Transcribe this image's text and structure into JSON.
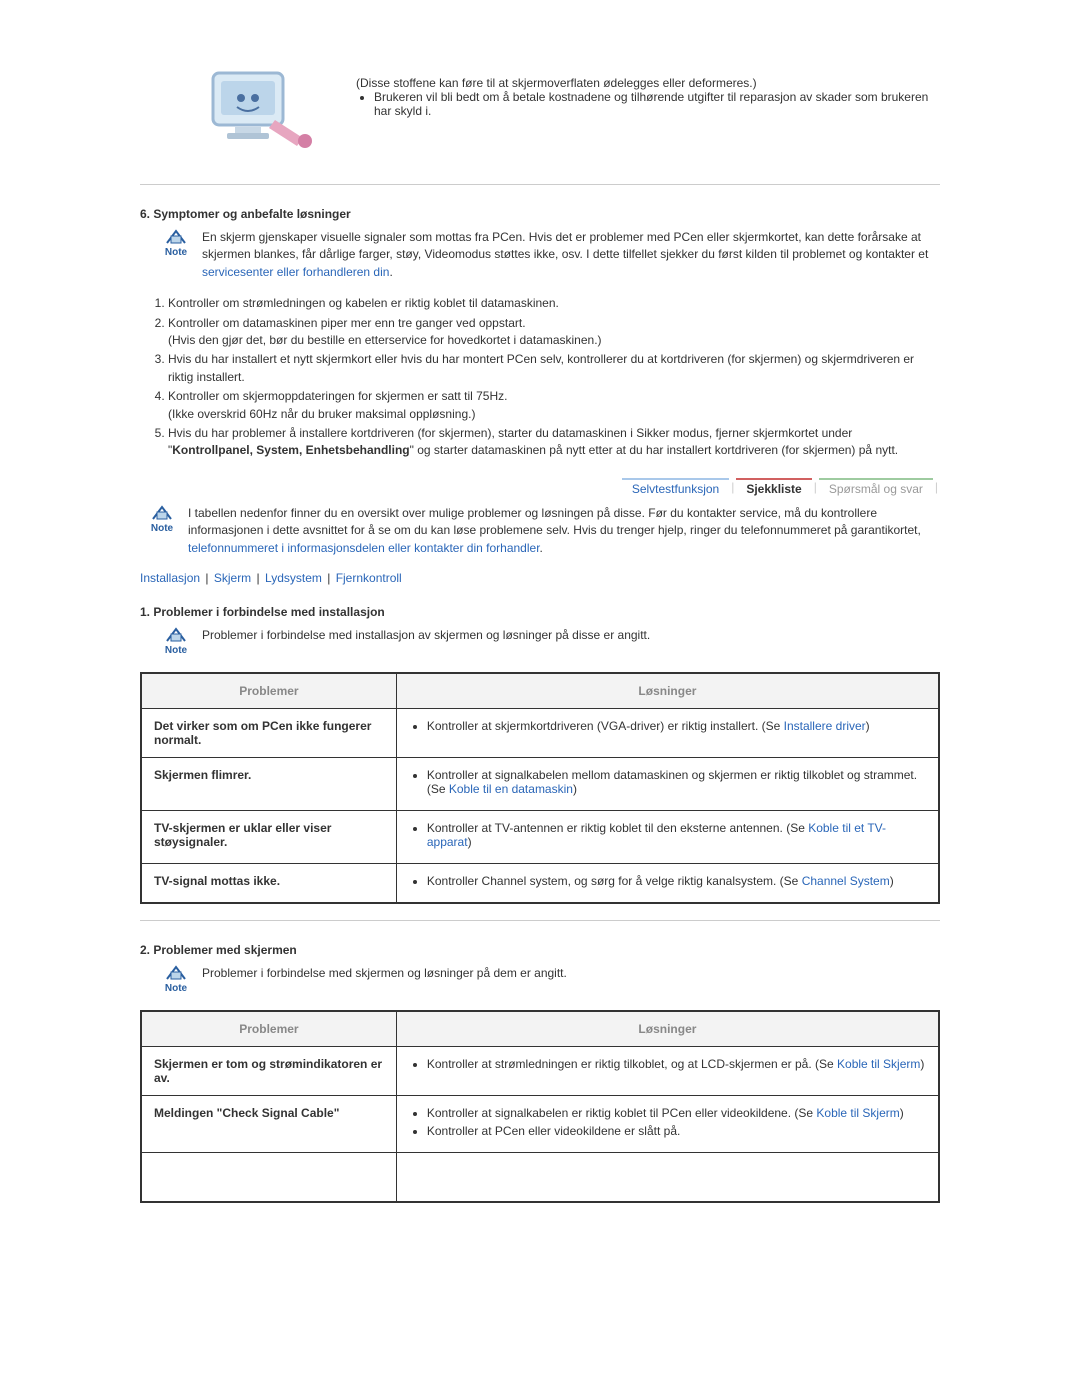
{
  "top": {
    "line1": "(Disse stoffene kan føre til at skjermoverflaten ødelegges eller deformeres.)",
    "line2_a": "Brukeren vil bli bedt om å betale kostnadene og tilhørende utgifter til reparasjon av skader som brukeren har skyld i."
  },
  "section6": {
    "title": "6. Symptomer og anbefalte løsninger",
    "note_label": "Note",
    "note_text_pre": "En skjerm gjenskaper visuelle signaler som mottas fra PCen. Hvis det er problemer med PCen eller skjermkortet, kan dette forårsake at skjermen blankes, får dårlige farger, støy, Videomodus støttes ikke, osv. I dette tilfellet sjekker du først kilden til problemet og kontakter et ",
    "note_link_text": "servicesenter eller forhandleren din",
    "note_text_post": ".",
    "checklist": {
      "i1": "Kontroller om strømledningen og kabelen er riktig koblet til datamaskinen.",
      "i2a": "Kontroller om datamaskinen piper mer enn tre ganger ved oppstart.",
      "i2b": "(Hvis den gjør det, bør du bestille en etterservice for hovedkortet i datamaskinen.)",
      "i3": "Hvis du har installert et nytt skjermkort eller hvis du har montert PCen selv, kontrollerer du at kortdriveren (for skjermen) og skjermdriveren er riktig installert.",
      "i4a": "Kontroller om skjermoppdateringen for skjermen er satt til 75Hz.",
      "i4b": "(Ikke overskrid 60Hz når du bruker maksimal oppløsning.)",
      "i5_pre": "Hvis du har problemer å installere kortdriveren (for skjermen), starter du datamaskinen i Sikker modus, fjerner skjermkortet under \"",
      "i5_bold": "Kontrollpanel, System, Enhetsbehandling",
      "i5_post": "\" og starter datamaskinen på nytt etter at du har installert kortdriveren (for skjermen) på nytt."
    }
  },
  "tabs_img": {
    "selvtest": "Selvtestfunksjon",
    "sjekkliste": "Sjekkliste",
    "sporsmal": "Spørsmål og svar"
  },
  "intro2": {
    "note_label": "Note",
    "text_pre": "I tabellen nedenfor finner du en oversikt over mulige problemer og løsningen på disse. Før du kontakter service, må du kontrollere informasjonen i dette avsnittet for å se om du kan løse problemene selv. Hvis du trenger hjelp, ringer du telefonnummeret på garantikortet, ",
    "link_text": "telefonnummeret i informasjonsdelen eller kontakter din forhandler",
    "text_post": "."
  },
  "inline_tabs": {
    "installasjon": "Installasjon",
    "skjerm": "Skjerm",
    "lydsystem": "Lydsystem",
    "fjernkontroll": "Fjernkontroll"
  },
  "section1": {
    "title": "1. Problemer i forbindelse med installasjon",
    "note_label": "Note",
    "note_text": "Problemer i forbindelse med installasjon av skjermen og løsninger på disse er angitt.",
    "th_problem": "Problemer",
    "th_solution": "Løsninger",
    "rows": [
      {
        "problem": "Det virker som om PCen ikke fungerer normalt.",
        "sol_pre": "Kontroller at skjermkortdriveren (VGA-driver) er riktig installert. (Se ",
        "sol_link": "Installere driver",
        "sol_post": ")"
      },
      {
        "problem": "Skjermen flimrer.",
        "sol_pre": "Kontroller at signalkabelen mellom datamaskinen og skjermen er riktig tilkoblet og strammet. (Se ",
        "sol_link": "Koble til en datamaskin",
        "sol_post": ")"
      },
      {
        "problem": "TV-skjermen er uklar eller viser støysignaler.",
        "sol_pre": "Kontroller at TV-antennen er riktig koblet til den eksterne antennen. (Se ",
        "sol_link": "Koble til et TV-apparat",
        "sol_post": ")"
      },
      {
        "problem": "TV-signal mottas ikke.",
        "sol_pre": "Kontroller Channel system, og sørg for å velge riktig kanalsystem. (Se ",
        "sol_link": "Channel System",
        "sol_post": ")"
      }
    ]
  },
  "section2": {
    "title": "2. Problemer med skjermen",
    "note_label": "Note",
    "note_text": "Problemer i forbindelse med skjermen og løsninger på dem er angitt.",
    "th_problem": "Problemer",
    "th_solution": "Løsninger",
    "rows": [
      {
        "problem": "Skjermen er tom og strømindikatoren er av.",
        "sol_pre": "Kontroller at strømledningen er riktig tilkoblet, og at LCD-skjermen er på. (Se ",
        "sol_link": "Koble til Skjerm",
        "sol_post": ")"
      },
      {
        "problem": "Meldingen \"Check Signal Cable\"",
        "sol_pre": "Kontroller at signalkabelen er riktig koblet til PCen eller videokildene. (Se ",
        "sol_link": "Koble til Skjerm",
        "sol_post": ")",
        "sol2": "Kontroller at PCen eller videokildene er slått på."
      }
    ]
  }
}
